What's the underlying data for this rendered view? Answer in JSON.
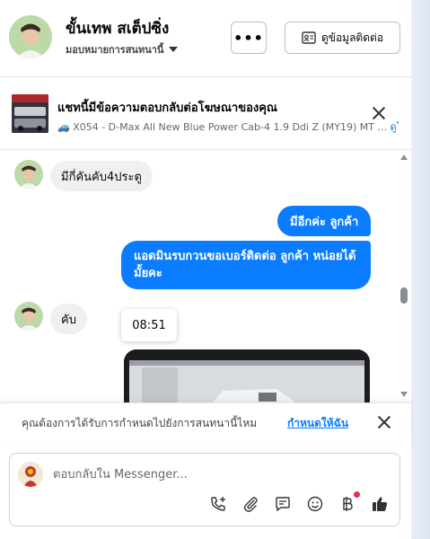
{
  "header": {
    "name": "ขั้นเทพ สเต็ปซิ่ง",
    "assign_label": "มอบหมายการสนทนานี้",
    "more_label": "•••",
    "contact_label": "ดูข้อมูลติดต่อ"
  },
  "ad": {
    "title": "แชทนี้มีข้อความตอบกลับต่อโฆษณาของคุณ",
    "subtitle": "🚙 X054 - D-Max All New Blue Power Cab-4 1.9 Ddi Z (MY19) MT ...",
    "link_label": "ดูโ"
  },
  "messages": [
    {
      "dir": "in",
      "text": "มีกี่คันคับ4ประตู"
    },
    {
      "dir": "out",
      "text": "มีอีกค่ะ  ลูกค้า"
    },
    {
      "dir": "out",
      "text": "แอดมินรบกวนขอเบอร์ติดต่อ ลูกค้า   หน่อยได้มั้ยคะ"
    },
    {
      "dir": "in",
      "text": "คับ"
    }
  ],
  "time_tooltip": "08:51",
  "assign_prompt": {
    "text": "คุณต้องการได้รับการกำหนดไปยังการสนทนานี้ไหม",
    "link": "กำหนดให้ฉัน"
  },
  "composer": {
    "placeholder": "ตอบกลับใน Messenger..."
  },
  "icons": {
    "header_more": "more-icon",
    "contact": "contact-card-icon",
    "tools": [
      "call-add-icon",
      "attachment-icon",
      "saved-reply-icon",
      "emoji-icon",
      "baht-payment-icon",
      "thumbs-up-icon"
    ]
  },
  "colors": {
    "accent": "#0a7cff",
    "incoming_bubble": "#f0f0f0",
    "notification_dot": "#f02849"
  }
}
